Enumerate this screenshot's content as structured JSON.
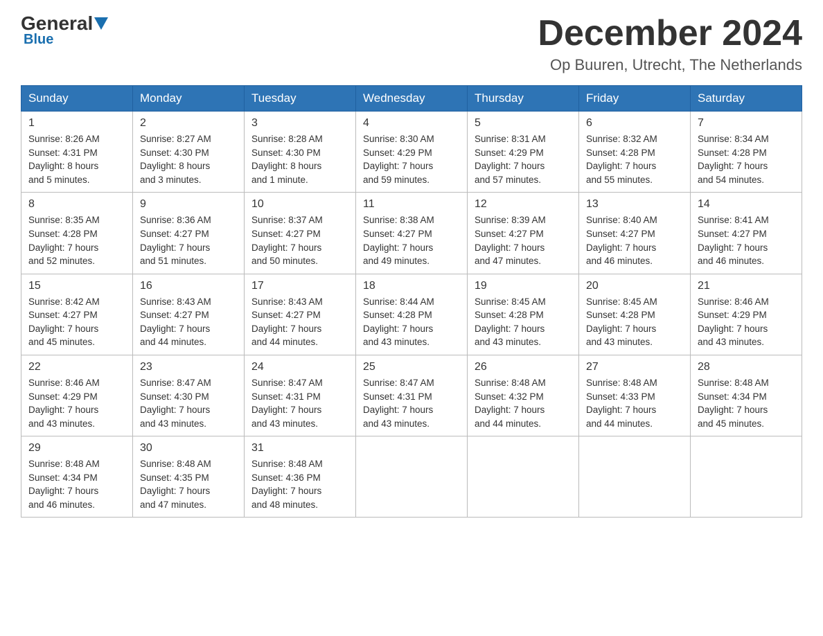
{
  "header": {
    "logo": {
      "general": "General",
      "blue": "Blue"
    },
    "title": "December 2024",
    "subtitle": "Op Buuren, Utrecht, The Netherlands"
  },
  "calendar": {
    "headers": [
      "Sunday",
      "Monday",
      "Tuesday",
      "Wednesday",
      "Thursday",
      "Friday",
      "Saturday"
    ],
    "weeks": [
      [
        {
          "day": "1",
          "sunrise": "8:26 AM",
          "sunset": "4:31 PM",
          "daylight": "8 hours and 5 minutes."
        },
        {
          "day": "2",
          "sunrise": "8:27 AM",
          "sunset": "4:30 PM",
          "daylight": "8 hours and 3 minutes."
        },
        {
          "day": "3",
          "sunrise": "8:28 AM",
          "sunset": "4:30 PM",
          "daylight": "8 hours and 1 minute."
        },
        {
          "day": "4",
          "sunrise": "8:30 AM",
          "sunset": "4:29 PM",
          "daylight": "7 hours and 59 minutes."
        },
        {
          "day": "5",
          "sunrise": "8:31 AM",
          "sunset": "4:29 PM",
          "daylight": "7 hours and 57 minutes."
        },
        {
          "day": "6",
          "sunrise": "8:32 AM",
          "sunset": "4:28 PM",
          "daylight": "7 hours and 55 minutes."
        },
        {
          "day": "7",
          "sunrise": "8:34 AM",
          "sunset": "4:28 PM",
          "daylight": "7 hours and 54 minutes."
        }
      ],
      [
        {
          "day": "8",
          "sunrise": "8:35 AM",
          "sunset": "4:28 PM",
          "daylight": "7 hours and 52 minutes."
        },
        {
          "day": "9",
          "sunrise": "8:36 AM",
          "sunset": "4:27 PM",
          "daylight": "7 hours and 51 minutes."
        },
        {
          "day": "10",
          "sunrise": "8:37 AM",
          "sunset": "4:27 PM",
          "daylight": "7 hours and 50 minutes."
        },
        {
          "day": "11",
          "sunrise": "8:38 AM",
          "sunset": "4:27 PM",
          "daylight": "7 hours and 49 minutes."
        },
        {
          "day": "12",
          "sunrise": "8:39 AM",
          "sunset": "4:27 PM",
          "daylight": "7 hours and 47 minutes."
        },
        {
          "day": "13",
          "sunrise": "8:40 AM",
          "sunset": "4:27 PM",
          "daylight": "7 hours and 46 minutes."
        },
        {
          "day": "14",
          "sunrise": "8:41 AM",
          "sunset": "4:27 PM",
          "daylight": "7 hours and 46 minutes."
        }
      ],
      [
        {
          "day": "15",
          "sunrise": "8:42 AM",
          "sunset": "4:27 PM",
          "daylight": "7 hours and 45 minutes."
        },
        {
          "day": "16",
          "sunrise": "8:43 AM",
          "sunset": "4:27 PM",
          "daylight": "7 hours and 44 minutes."
        },
        {
          "day": "17",
          "sunrise": "8:43 AM",
          "sunset": "4:27 PM",
          "daylight": "7 hours and 44 minutes."
        },
        {
          "day": "18",
          "sunrise": "8:44 AM",
          "sunset": "4:28 PM",
          "daylight": "7 hours and 43 minutes."
        },
        {
          "day": "19",
          "sunrise": "8:45 AM",
          "sunset": "4:28 PM",
          "daylight": "7 hours and 43 minutes."
        },
        {
          "day": "20",
          "sunrise": "8:45 AM",
          "sunset": "4:28 PM",
          "daylight": "7 hours and 43 minutes."
        },
        {
          "day": "21",
          "sunrise": "8:46 AM",
          "sunset": "4:29 PM",
          "daylight": "7 hours and 43 minutes."
        }
      ],
      [
        {
          "day": "22",
          "sunrise": "8:46 AM",
          "sunset": "4:29 PM",
          "daylight": "7 hours and 43 minutes."
        },
        {
          "day": "23",
          "sunrise": "8:47 AM",
          "sunset": "4:30 PM",
          "daylight": "7 hours and 43 minutes."
        },
        {
          "day": "24",
          "sunrise": "8:47 AM",
          "sunset": "4:31 PM",
          "daylight": "7 hours and 43 minutes."
        },
        {
          "day": "25",
          "sunrise": "8:47 AM",
          "sunset": "4:31 PM",
          "daylight": "7 hours and 43 minutes."
        },
        {
          "day": "26",
          "sunrise": "8:48 AM",
          "sunset": "4:32 PM",
          "daylight": "7 hours and 44 minutes."
        },
        {
          "day": "27",
          "sunrise": "8:48 AM",
          "sunset": "4:33 PM",
          "daylight": "7 hours and 44 minutes."
        },
        {
          "day": "28",
          "sunrise": "8:48 AM",
          "sunset": "4:34 PM",
          "daylight": "7 hours and 45 minutes."
        }
      ],
      [
        {
          "day": "29",
          "sunrise": "8:48 AM",
          "sunset": "4:34 PM",
          "daylight": "7 hours and 46 minutes."
        },
        {
          "day": "30",
          "sunrise": "8:48 AM",
          "sunset": "4:35 PM",
          "daylight": "7 hours and 47 minutes."
        },
        {
          "day": "31",
          "sunrise": "8:48 AM",
          "sunset": "4:36 PM",
          "daylight": "7 hours and 48 minutes."
        },
        null,
        null,
        null,
        null
      ]
    ],
    "labels": {
      "sunrise": "Sunrise:",
      "sunset": "Sunset:",
      "daylight": "Daylight:"
    }
  }
}
